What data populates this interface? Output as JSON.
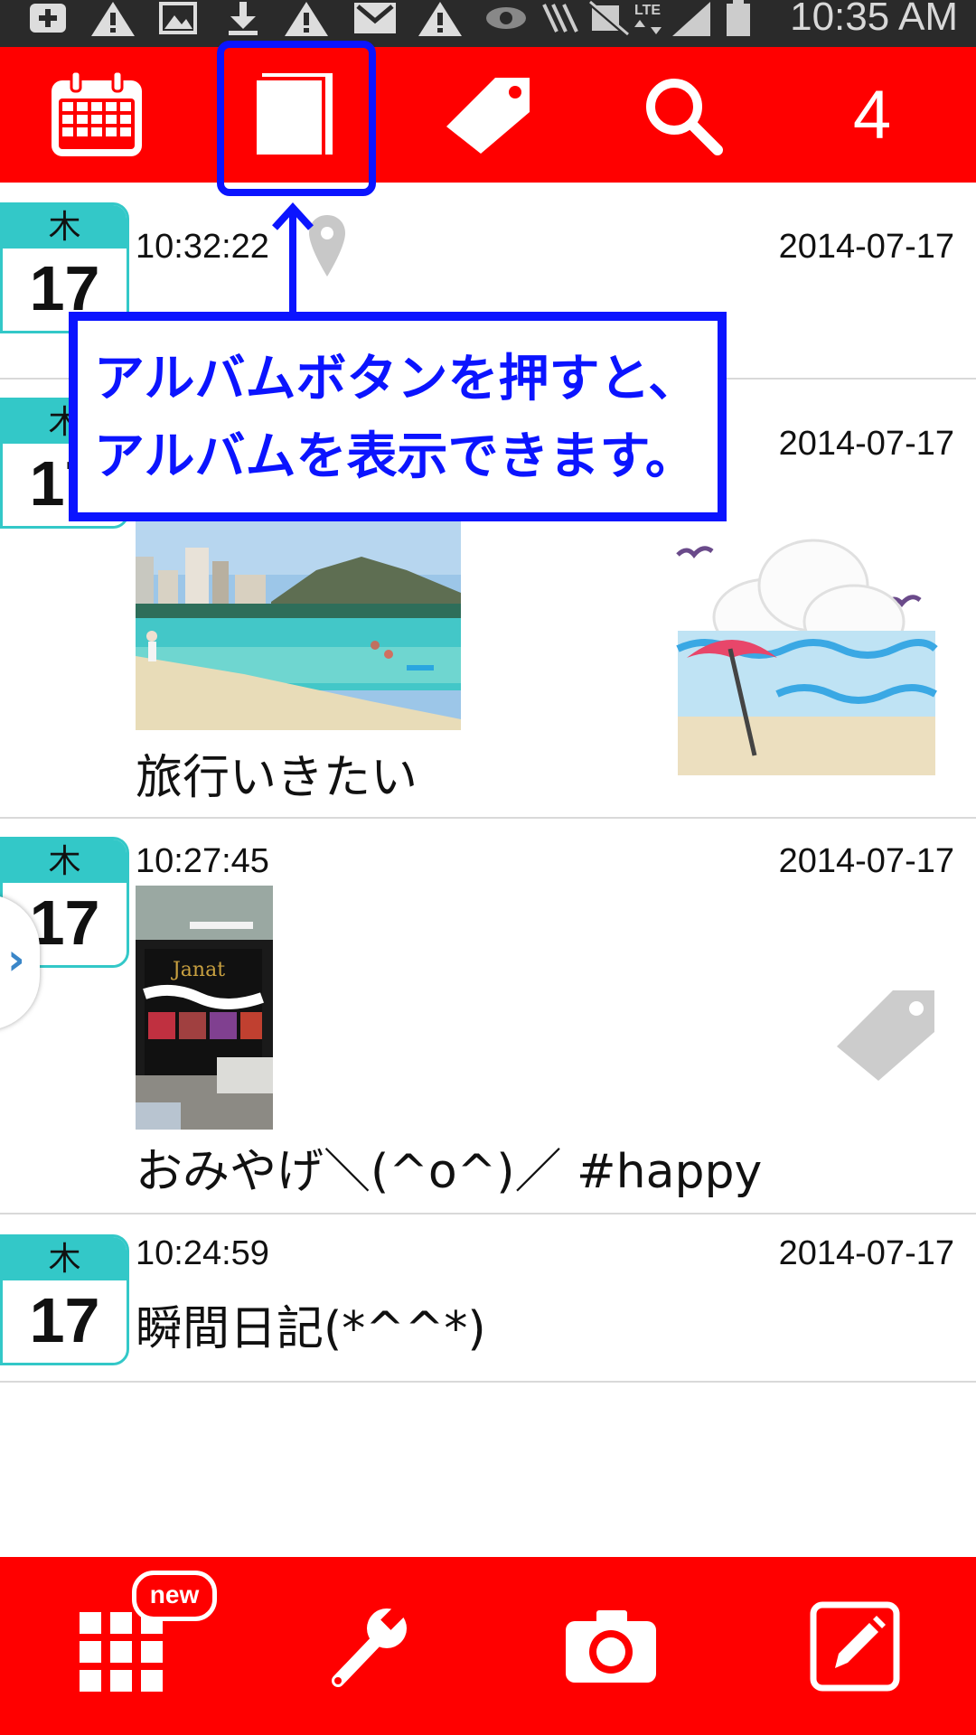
{
  "status_bar": {
    "time": "10:35 AM",
    "icons": [
      "plus-icon",
      "warning-icon",
      "image-icon",
      "download-icon",
      "warning-icon",
      "gmail-icon",
      "warning-icon",
      "eye-icon",
      "nfc-icon",
      "mute-icon",
      "lte-icon",
      "signal-icon",
      "battery-icon"
    ]
  },
  "toolbar": {
    "buttons": [
      "calendar-icon",
      "album-icon",
      "tag-icon",
      "search-icon"
    ],
    "count": "4",
    "accent": "#ff0000",
    "highlight_color": "#0b14ff"
  },
  "callout": {
    "line1": "アルバムボタンを押すと、",
    "line2": "アルバムを表示できます。"
  },
  "entries": [
    {
      "weekday": "木",
      "day": "17",
      "time": "10:32:22",
      "date": "2014-07-17",
      "text": ""
    },
    {
      "weekday": "木",
      "day": "17",
      "time": "",
      "date": "2014-07-17",
      "text": "旅行いきたい"
    },
    {
      "weekday": "木",
      "day": "17",
      "time": "10:27:45",
      "date": "2014-07-17",
      "text": "おみやげ＼(^o^)／ #happy"
    },
    {
      "weekday": "木",
      "day": "17",
      "time": "10:24:59",
      "date": "2014-07-17",
      "text": "瞬間日記(*^^*)"
    }
  ],
  "bottom_bar": {
    "new_badge": "new",
    "buttons": [
      "apps-grid-icon",
      "wrench-icon",
      "camera-icon",
      "edit-icon"
    ]
  }
}
